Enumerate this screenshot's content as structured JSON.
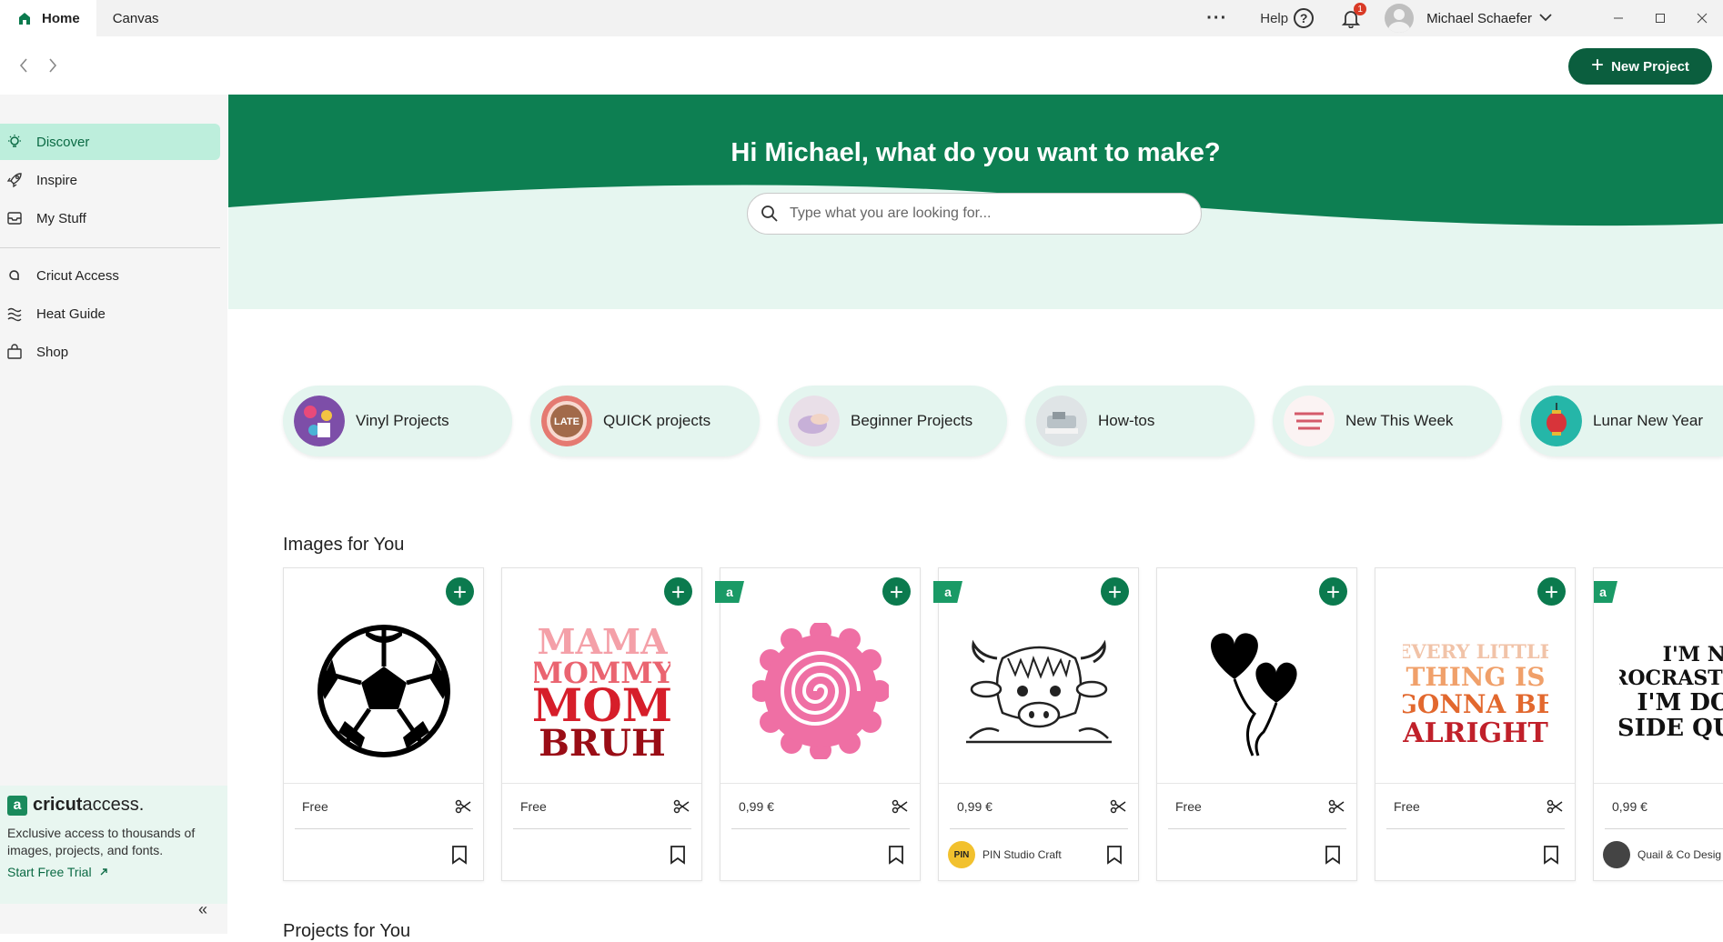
{
  "titlebar": {
    "tabs": [
      {
        "label": "Home",
        "icon": "home-icon"
      },
      {
        "label": "Canvas"
      }
    ],
    "help_label": "Help",
    "notification_count": "1",
    "user_name": "Michael Schaefer"
  },
  "toolbar": {
    "new_project_label": "New Project"
  },
  "sidebar": {
    "items": [
      {
        "label": "Discover",
        "icon": "lightbulb-icon",
        "active": true
      },
      {
        "label": "Inspire",
        "icon": "rocket-icon"
      },
      {
        "label": "My Stuff",
        "icon": "inbox-icon"
      },
      {
        "label": "Cricut Access",
        "icon": "cricut-access-icon"
      },
      {
        "label": "Heat Guide",
        "icon": "heat-waves-icon"
      },
      {
        "label": "Shop",
        "icon": "shopping-bag-icon"
      }
    ],
    "access_card": {
      "logo_bold": "cricut",
      "logo_light": "access.",
      "description": "Exclusive access to thousands of images, projects, and fonts.",
      "cta": "Start Free Trial"
    }
  },
  "hero": {
    "title": "Hi Michael, what do you want to make?",
    "search_placeholder": "Type what you are looking for..."
  },
  "categories": [
    {
      "label": "Vinyl Projects"
    },
    {
      "label": "QUICK projects",
      "thumb_text": "LATE"
    },
    {
      "label": "Beginner Projects"
    },
    {
      "label": "How-tos"
    },
    {
      "label": "New This Week"
    },
    {
      "label": "Lunar New Year"
    }
  ],
  "images_section": {
    "title": "Images for You",
    "cards": [
      {
        "price": "Free",
        "access": false,
        "image": "soccer-ball"
      },
      {
        "price": "Free",
        "access": false,
        "image": "mama-mommy-mom-bruh",
        "art_lines": [
          "MAMA",
          "MOMMY",
          "MOM",
          "BRUH"
        ]
      },
      {
        "price": "0,99 €",
        "access": true,
        "image": "rolled-flower"
      },
      {
        "price": "0,99 €",
        "access": true,
        "image": "highland-cow",
        "designer": "PIN Studio Craft",
        "designer_avatar_text": "PIN"
      },
      {
        "price": "Free",
        "access": false,
        "image": "heart-balloons"
      },
      {
        "price": "Free",
        "access": false,
        "image": "every-little-thing",
        "art_lines": [
          "EVERY LITTLE",
          "THING IS",
          "GONNA BE",
          "ALRIGHT"
        ]
      },
      {
        "price": "0,99 €",
        "access": true,
        "image": "procrastinating-text",
        "designer": "Quail & Co Desig",
        "art_lines": [
          "I'M NOT",
          "PROCRASTINATING",
          "I'M DOING",
          "SIDE QUESTS"
        ]
      }
    ]
  },
  "next_section_title": "Projects for You",
  "colors": {
    "brand_green": "#0b5e3e",
    "hero_green": "#0d7f52",
    "accent_light": "#bdeedc"
  }
}
